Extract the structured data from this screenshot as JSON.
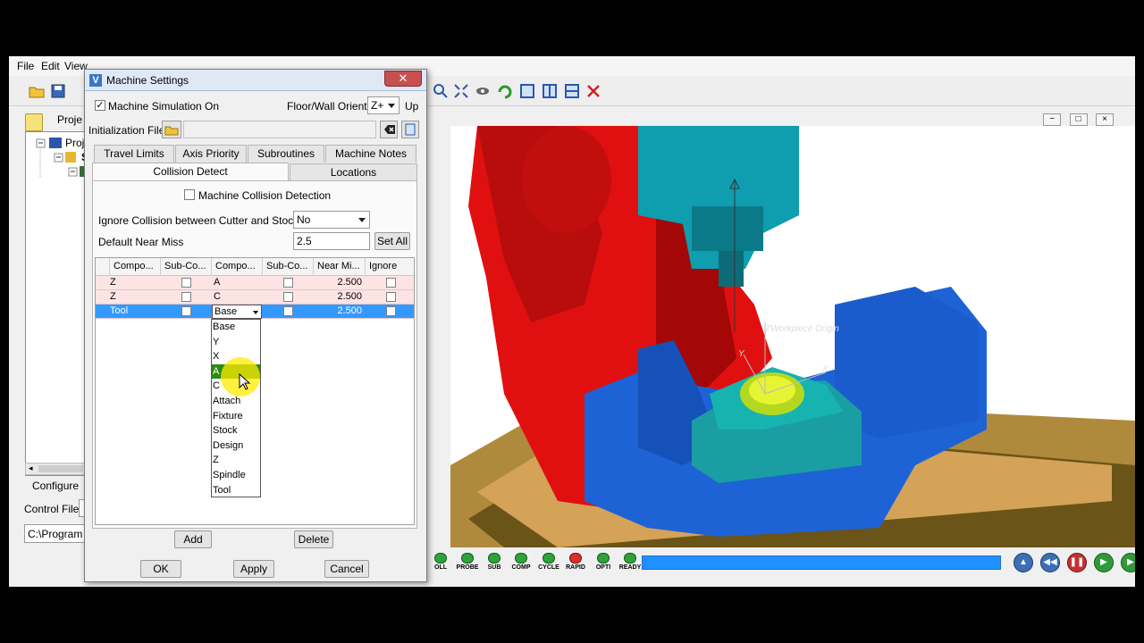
{
  "app": {
    "menu": [
      "File",
      "Edit",
      "View"
    ],
    "project_label": "Proje",
    "tree_items": [
      "Proje",
      "S"
    ],
    "configure_label": "Configure",
    "control_file_label": "Control File",
    "path_value": "C:\\Program",
    "viewport_controls": [
      "−",
      "□",
      "×"
    ],
    "scene_labels": {
      "workpiece_origin": "ZWorkpiece Origin",
      "axis_y": "Y",
      "axis_x": "X"
    },
    "status_buttons": [
      {
        "label": "OLL",
        "color": "green"
      },
      {
        "label": "PROBE",
        "color": "green"
      },
      {
        "label": "SUB",
        "color": "green"
      },
      {
        "label": "COMP",
        "color": "green"
      },
      {
        "label": "CYCLE",
        "color": "green"
      },
      {
        "label": "RAPID",
        "color": "red"
      },
      {
        "label": "OPTI",
        "color": "green"
      },
      {
        "label": "READY",
        "color": "green"
      }
    ],
    "progress": 1.0
  },
  "dialog": {
    "title": "Machine Settings",
    "close_symbol": "✕",
    "machine_simulation_label": "Machine Simulation On",
    "machine_simulation_checked": true,
    "floor_wall_label": "Floor/Wall Orient",
    "floor_wall_value": "Z+",
    "up_label": "Up",
    "init_file_label": "Initialization File",
    "tabs_row1": [
      "Travel Limits",
      "Axis Priority",
      "Subroutines",
      "Machine Notes"
    ],
    "tabs_row2": [
      "Collision Detect",
      "Locations"
    ],
    "active_tab": "Collision Detect",
    "machine_collision_label": "Machine Collision Detection",
    "machine_collision_checked": false,
    "ignore_collision_label": "Ignore Collision between Cutter and Stock",
    "ignore_collision_value": "No",
    "default_near_miss_label": "Default Near Miss",
    "default_near_miss_value": "2.5",
    "set_all_label": "Set All",
    "grid": {
      "headers": [
        "Compo...",
        "Sub-Co...",
        "Compo...",
        "Sub-Co...",
        "Near Mi...",
        "Ignore"
      ],
      "rows": [
        {
          "comp1": "Z",
          "comp2": "A",
          "near": "2.500"
        },
        {
          "comp1": "Z",
          "comp2": "C",
          "near": "2.500"
        },
        {
          "comp1": "Tool",
          "comp2": "Base",
          "near": "2.500"
        }
      ]
    },
    "dropdown_options": [
      "Base",
      "Y",
      "X",
      "A",
      "C",
      "Attach",
      "Fixture",
      "Stock",
      "Design",
      "Z",
      "Spindle",
      "Tool"
    ],
    "dropdown_highlight": "A",
    "add_label": "Add",
    "delete_label": "Delete",
    "ok_label": "OK",
    "apply_label": "Apply",
    "cancel_label": "Cancel"
  }
}
